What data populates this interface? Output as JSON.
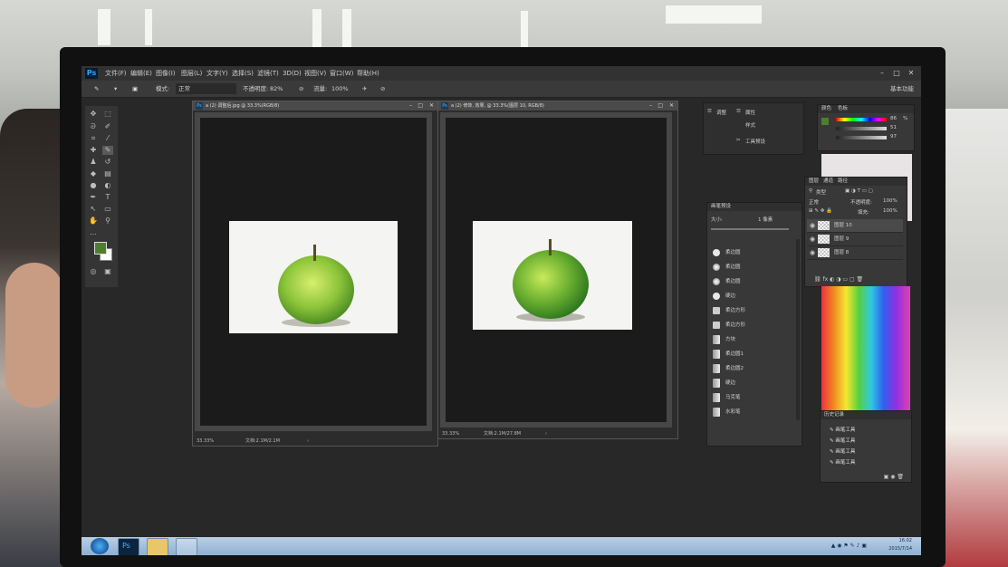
{
  "app": {
    "logo": "Ps",
    "menu": [
      "文件(F)",
      "编辑(E)",
      "图像(I)",
      "图层(L)",
      "文字(Y)",
      "选择(S)",
      "滤镜(T)",
      "3D(D)",
      "视图(V)",
      "窗口(W)",
      "帮助(H)"
    ],
    "workspace": "基本功能"
  },
  "options_bar": {
    "mode_label": "模式:",
    "mode_value": "正常",
    "opacity_label": "不透明度:",
    "opacity_value": "82%",
    "flow_label": "流量:",
    "flow_value": "100%"
  },
  "documents": [
    {
      "title": "a (2) 调整后.jpg @ 33.3%(RGB/8)",
      "zoom": "33.33%",
      "doc_size": "文档:2.1M/2.1M"
    },
    {
      "title": "a (2) 修饰, 效果, @ 33.3%(图层 10, RGB/8)",
      "zoom": "33.33%",
      "doc_size": "文档:2.1M/27.8M"
    }
  ],
  "mini_panel": {
    "items": [
      "调整",
      "属性",
      "样式",
      "工具预设"
    ]
  },
  "brush_presets": {
    "title": "画笔预设",
    "size_label": "大小:",
    "size_value": "1 像素",
    "items": [
      "柔边圆",
      "柔边圆",
      "柔边圆",
      "硬边",
      "柔边方形",
      "柔边方形",
      "方块",
      "柔边圆1",
      "柔边圆2",
      "硬边",
      "马克笔",
      "水彩笔"
    ]
  },
  "color_panel": {
    "tabs": [
      "颜色",
      "色板"
    ],
    "values": [
      "86",
      "51",
      "97"
    ],
    "unit": "%"
  },
  "layers": {
    "tabs": [
      "图层",
      "通道",
      "路径"
    ],
    "kind_label": "类型",
    "blend_mode": "正常",
    "opacity_label": "不透明度:",
    "opacity_value": "100%",
    "fill_label": "填充:",
    "fill_value": "100%",
    "items": [
      "图层 10",
      "图层 9",
      "图层 8"
    ]
  },
  "history": {
    "title": "历史记录",
    "items": [
      "画笔工具",
      "画笔工具",
      "画笔工具",
      "画笔工具"
    ]
  },
  "taskbar": {
    "time": "16:02",
    "date": "2015/7/14"
  }
}
